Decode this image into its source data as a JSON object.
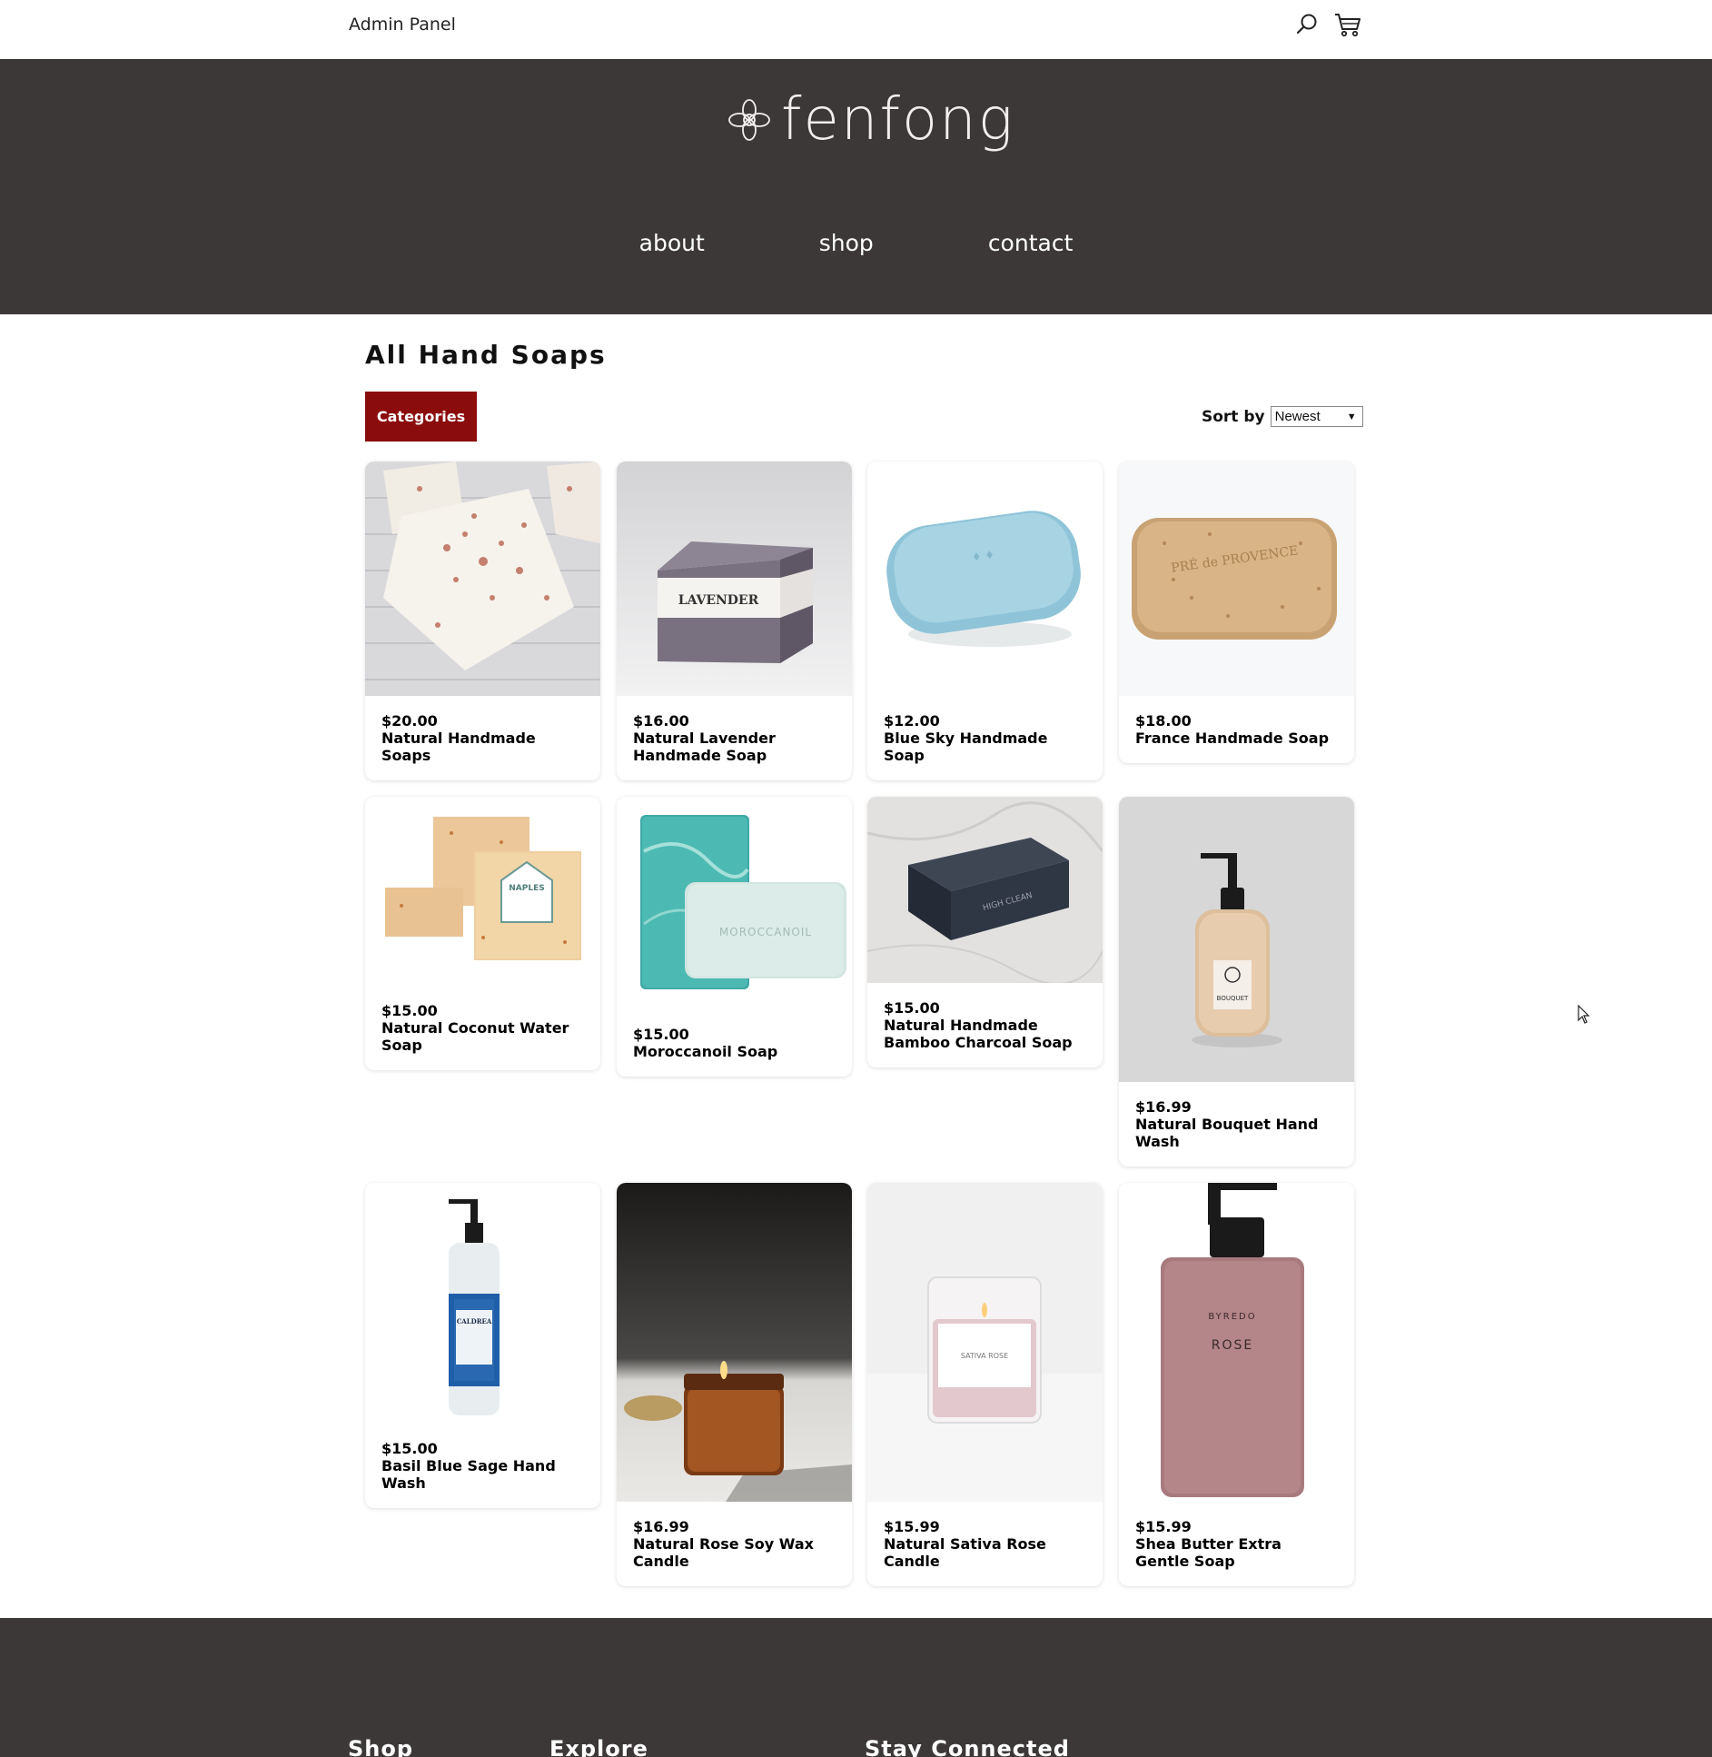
{
  "topbar": {
    "admin_label": "Admin Panel"
  },
  "icons": {
    "search": "search-icon",
    "cart": "cart-icon"
  },
  "header": {
    "brand": "fenfong"
  },
  "nav": [
    {
      "label": "about"
    },
    {
      "label": "shop"
    },
    {
      "label": "contact"
    }
  ],
  "main": {
    "title": "All Hand Soaps",
    "categories_label": "Categories",
    "sort_label": "Sort by",
    "sort_value": "Newest"
  },
  "colors": {
    "header_bg": "#3c3838",
    "accent": "#8b0c0c"
  },
  "products": [
    {
      "price": "$20.00",
      "name": "Natural Handmade Soaps"
    },
    {
      "price": "$16.00",
      "name": "Natural Lavender Handmade Soap"
    },
    {
      "price": "$12.00",
      "name": "Blue Sky Handmade Soap"
    },
    {
      "price": "$18.00",
      "name": "France Handmade Soap"
    },
    {
      "price": "$15.00",
      "name": "Natural Coconut Water Soap"
    },
    {
      "price": "$15.00",
      "name": "Moroccanoil Soap"
    },
    {
      "price": "$15.00",
      "name": "Natural Handmade Bamboo Charcoal Soap"
    },
    {
      "price": "$16.99",
      "name": "Natural Bouquet Hand Wash"
    },
    {
      "price": "$15.00",
      "name": "Basil Blue Sage Hand Wash"
    },
    {
      "price": "$16.99",
      "name": "Natural Rose Soy Wax Candle"
    },
    {
      "price": "$15.99",
      "name": "Natural Sativa Rose Candle"
    },
    {
      "price": "$15.99",
      "name": "Shea Butter Extra Gentle Soap"
    }
  ],
  "product_images": {
    "p1_label": "",
    "lavender_label": "LAVENDER",
    "naples_label": "NAPLES",
    "moroccanoil_label": "MOROCCANOIL",
    "charcoal_label": "HIGH CLEAN",
    "bouquet_label": "BOUQUET",
    "caldrea_label": "CALDREA",
    "sativa_label": "SATIVA ROSE",
    "byredo_brand": "BYREDO",
    "byredo_label": "ROSE",
    "provence_label": "PRÉ de PROVENCE"
  },
  "footer": {
    "col1": "Shop",
    "col2": "Explore",
    "col3": "Stay Connected"
  }
}
